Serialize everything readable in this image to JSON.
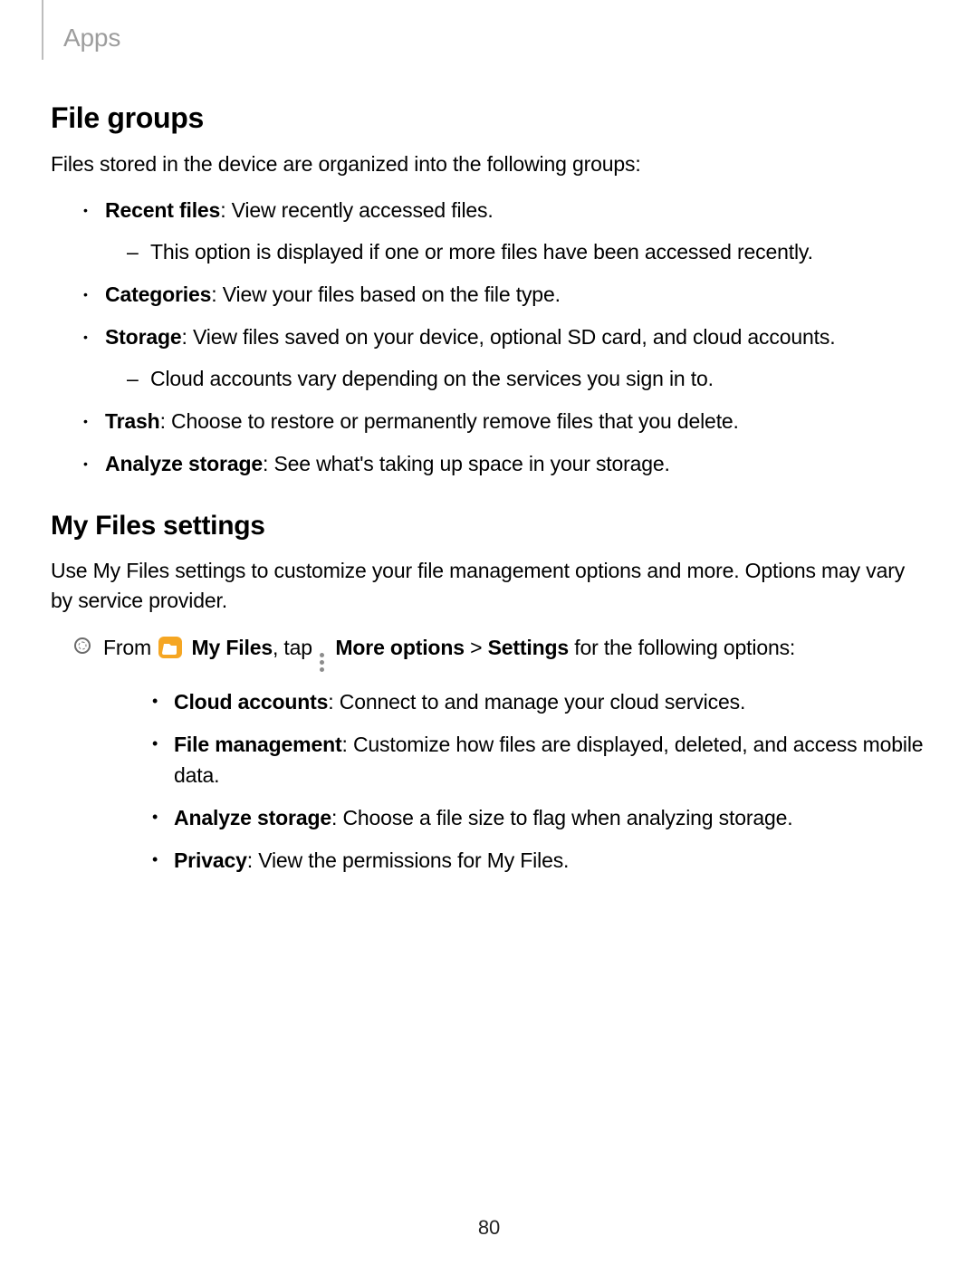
{
  "header": {
    "section_tab": "Apps"
  },
  "s1": {
    "h": "File groups",
    "intro": "Files stored in the device are organized into the following groups:",
    "items": [
      {
        "b": "Recent files",
        "t": ": View recently accessed files.",
        "sub": [
          "This option is displayed if one or more files have been accessed recently."
        ]
      },
      {
        "b": "Categories",
        "t": ": View your files based on the file type."
      },
      {
        "b": "Storage",
        "t": ": View files saved on your device, optional SD card, and cloud accounts.",
        "sub": [
          "Cloud accounts vary depending on the services you sign in to."
        ]
      },
      {
        "b": "Trash",
        "t": ": Choose to restore or permanently remove files that you delete."
      },
      {
        "b": "Analyze storage",
        "t": ": See what's taking up space in your storage."
      }
    ]
  },
  "s2": {
    "h": "My Files settings",
    "intro": "Use My Files settings to customize your file management options and more. Options may vary by service provider.",
    "step": {
      "pre": "From ",
      "app": " My Files",
      "mid1": ", tap ",
      "more": " More options",
      "mid2": " > ",
      "settings": "Settings",
      "post": " for the following options:"
    },
    "opts": [
      {
        "b": "Cloud accounts",
        "t": ": Connect to and manage your cloud services."
      },
      {
        "b": "File management",
        "t": ": Customize how files are displayed, deleted, and access mobile data."
      },
      {
        "b": "Analyze storage",
        "t": ": Choose a file size to flag when analyzing storage."
      },
      {
        "b": "Privacy",
        "t": ": View the permissions for My Files."
      }
    ]
  },
  "page_number": "80",
  "icons": {
    "folder_color": "#f5a623"
  }
}
